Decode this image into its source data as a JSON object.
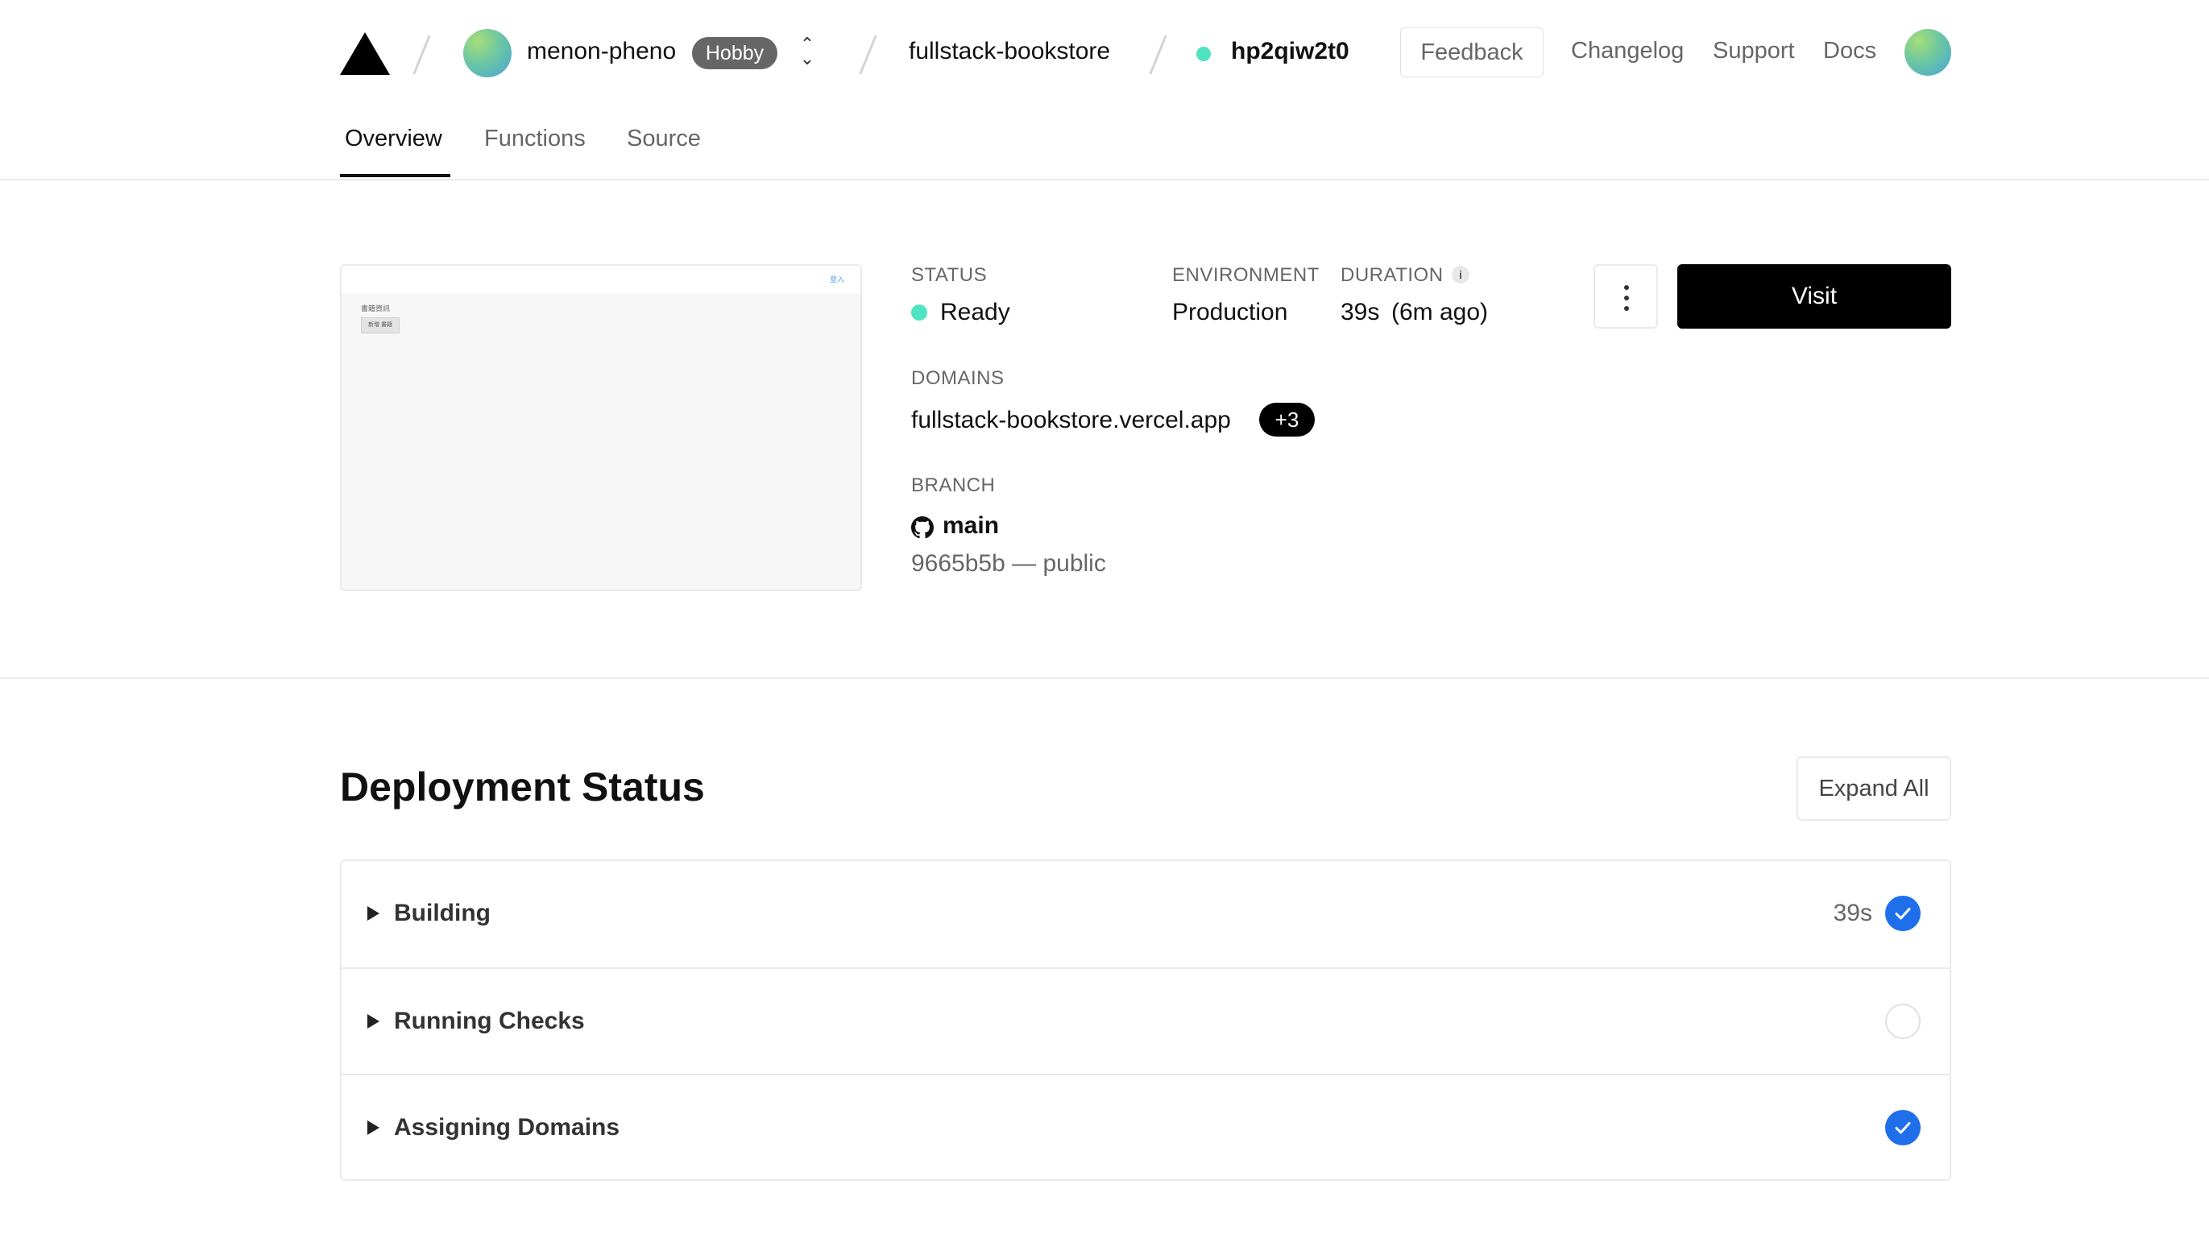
{
  "header": {
    "team": {
      "name": "menon-pheno",
      "plan": "Hobby"
    },
    "project": "fullstack-bookstore",
    "deployment_id": "hp2qiw2t0",
    "feedback_label": "Feedback",
    "links": [
      "Changelog",
      "Support",
      "Docs"
    ]
  },
  "tabs": [
    {
      "label": "Overview",
      "active": true
    },
    {
      "label": "Functions",
      "active": false
    },
    {
      "label": "Source",
      "active": false
    }
  ],
  "preview": {
    "title_text": "書籍資訊",
    "button_text": "新增 書籍",
    "link_text": "登入"
  },
  "details": {
    "status_label": "STATUS",
    "status_value": "Ready",
    "environment_label": "ENVIRONMENT",
    "environment_value": "Production",
    "duration_label": "DURATION",
    "duration_value": "39s",
    "duration_ago": "(6m ago)",
    "domains_label": "DOMAINS",
    "domain": "fullstack-bookstore.vercel.app",
    "domain_extra": "+3",
    "branch_label": "BRANCH",
    "branch": "main",
    "commit": "9665b5b — public"
  },
  "actions": {
    "visit_label": "Visit"
  },
  "deployment_status": {
    "title": "Deployment Status",
    "expand_label": "Expand All",
    "steps": [
      {
        "label": "Building",
        "time": "39s",
        "state": "done"
      },
      {
        "label": "Running Checks",
        "time": "",
        "state": "pending"
      },
      {
        "label": "Assigning Domains",
        "time": "",
        "state": "done"
      }
    ]
  },
  "colors": {
    "ready": "#50e3c2",
    "check": "#1f6feb",
    "visit_bg": "#000000"
  },
  "icons": [
    "vercel-logo-icon",
    "chevron-updown-icon",
    "info-icon",
    "more-vertical-icon",
    "github-icon",
    "caret-right-icon",
    "check-circle-icon"
  ]
}
